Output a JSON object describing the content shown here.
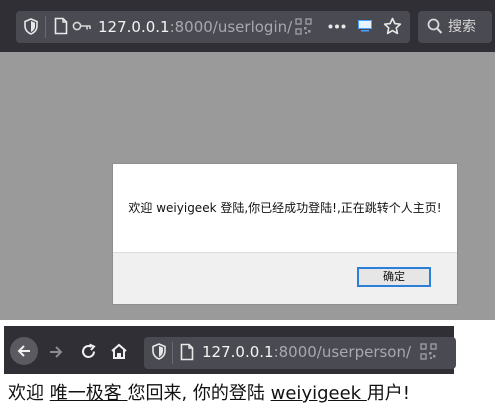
{
  "top_browser": {
    "url_host": "127.0.0.1",
    "url_rest": ":8000/userlogin/",
    "search_label": "搜索"
  },
  "dialog": {
    "message": "欢迎 weiyigeek 登陆,你已经成功登陆!,正在跳转个人主页!",
    "ok_label": "确定"
  },
  "bottom_browser": {
    "url_host": "127.0.0.1",
    "url_rest": ":8000/userperson/"
  },
  "page": {
    "welcome_prefix": "欢迎 ",
    "nickname": "唯一极客 ",
    "middle_text": "您回来, 你的登陆 ",
    "username": "weiyigeek ",
    "suffix": "用户!"
  },
  "colors": {
    "chrome_bg": "#2f2f35",
    "urlbar_bg": "#4a4a52",
    "page_overlay": "#9a9a9a",
    "button_focus": "#2b7fd6"
  },
  "icons": [
    "shield-icon",
    "page-icon",
    "key-icon",
    "qr-icon",
    "more-icon",
    "screen-icon",
    "star-icon",
    "search-icon",
    "back-icon",
    "forward-icon",
    "reload-icon",
    "home-icon"
  ]
}
